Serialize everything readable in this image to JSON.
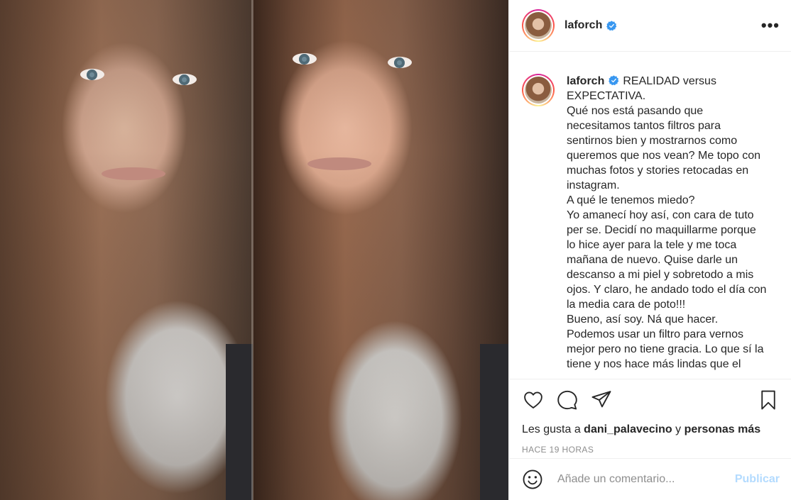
{
  "post": {
    "username": "laforch",
    "more_label": "•••",
    "caption_body": "REALIDAD versus EXPECTATIVA.\nQué nos está pasando que necesitamos tantos filtros para sentirnos bien y mostrarnos como queremos que nos vean? Me topo con muchas fotos y stories retocadas en instagram.\nA qué le tenemos miedo?\nYo amanecí hoy así, con cara de tuto per se. Decidí no maquillarme porque lo hice ayer para la tele y me toca mañana de nuevo. Quise darle un descanso a mi piel y sobretodo a mis ojos. Y claro, he andado todo el día con la media cara de poto!!!\nBueno, así soy. Ná que hacer.\nPodemos usar un filtro para vernos mejor pero no tiene gracia. Lo que sí la tiene y nos hace más lindas que el"
  },
  "likes": {
    "prefix": "Les gusta a ",
    "user": "dani_palavecino",
    "connector": " y ",
    "others": "personas más"
  },
  "timestamp": "HACE 19 HORAS",
  "comment": {
    "placeholder": "Añade un comentario...",
    "publish_label": "Publicar"
  },
  "icons": {
    "verified": "verified-badge-icon",
    "like": "heart-icon",
    "comment": "comment-bubble-icon",
    "share": "paper-plane-icon",
    "save": "bookmark-icon",
    "emoji": "smiley-icon"
  },
  "colors": {
    "verified_blue": "#3897f0",
    "publish_disabled": "#b3dbff",
    "meta_gray": "#8e8e8e"
  }
}
